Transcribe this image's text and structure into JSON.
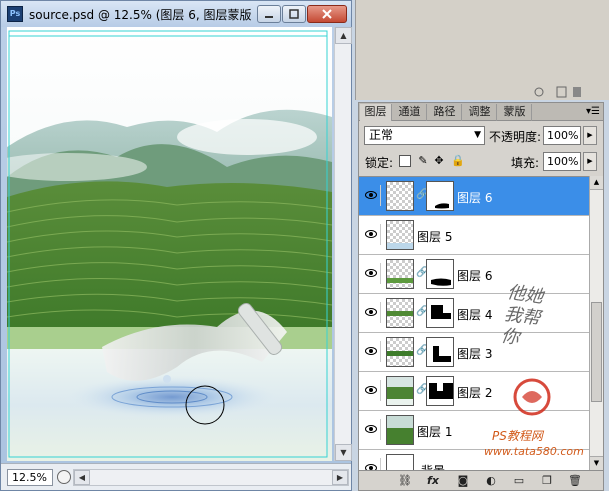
{
  "document_window": {
    "title": "source.psd @ 12.5% (图层 6, 图层蒙版/...",
    "app_icon": "Ps",
    "zoom": "12.5%",
    "buttons": {
      "minimize_icon": "minimize-icon",
      "maximize_icon": "maximize-icon",
      "close_icon": "close-icon"
    }
  },
  "layers_panel": {
    "tabs": [
      "图层",
      "通道",
      "路径",
      "调整",
      "蒙版"
    ],
    "active_tab": 0,
    "blend_mode": "正常",
    "opacity_label": "不透明度:",
    "opacity_value": "100%",
    "lock_label": "锁定:",
    "fill_label": "填充:",
    "fill_value": "100%",
    "layers": [
      {
        "name": "图层 6",
        "selected": true,
        "has_mask": true,
        "thumb": "transparent"
      },
      {
        "name": "图层 5",
        "selected": false,
        "has_mask": false,
        "thumb": "transparent-blue"
      },
      {
        "name": "图层 6",
        "selected": false,
        "has_mask": true,
        "thumb": "transparent-green"
      },
      {
        "name": "图层 4",
        "selected": false,
        "has_mask": true,
        "thumb": "transparent-green"
      },
      {
        "name": "图层 3",
        "selected": false,
        "has_mask": true,
        "thumb": "transparent-green"
      },
      {
        "name": "图层 2",
        "selected": false,
        "has_mask": true,
        "thumb": "landscape"
      },
      {
        "name": "图层 1",
        "selected": false,
        "has_mask": false,
        "thumb": "landscape"
      },
      {
        "name": "背景",
        "selected": false,
        "has_mask": false,
        "thumb": "white"
      }
    ],
    "bottom_icons": [
      "link-icon",
      "fx-icon",
      "mask-icon",
      "adjustment-icon",
      "folder-icon",
      "new-layer-icon",
      "trash-icon"
    ]
  },
  "watermark": {
    "line1": "他她我帮你",
    "line2": "PS教程网",
    "line3": "www.tata580.com"
  }
}
